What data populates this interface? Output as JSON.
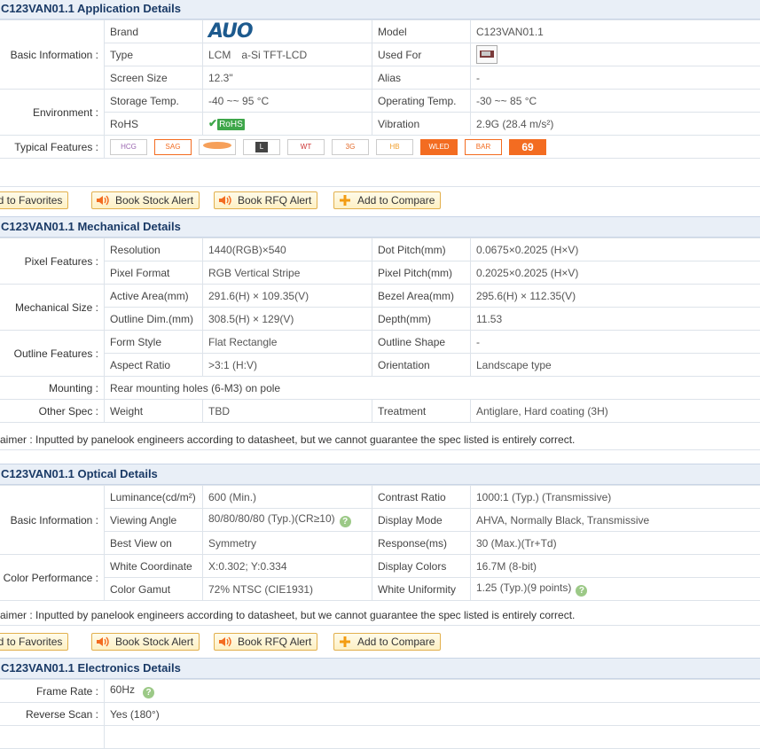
{
  "application": {
    "title": "C123VAN01.1 Application Details",
    "basic_info_header": "Basic Information :",
    "environment_header": "Environment :",
    "typical_features_header": "Typical Features :",
    "brand_label": "Brand",
    "brand_logo": "AUO",
    "model_label": "Model",
    "model_value": "C123VAN01.1",
    "type_label": "Type",
    "type_value_1": "LCM",
    "type_value_2": "a-Si TFT-LCD",
    "used_for_label": "Used For",
    "screen_size_label": "Screen Size",
    "screen_size_value": "12.3\"",
    "alias_label": "Alias",
    "alias_value": "-",
    "storage_label": "Storage Temp.",
    "storage_value": "-40 ~~ 95 °C",
    "operating_label": "Operating Temp.",
    "operating_value": "-30 ~~ 85 °C",
    "rohs_label": "RoHS",
    "rohs_badge": "RoHS",
    "vibration_label": "Vibration",
    "vibration_value": "2.9G (28.4 m/s²)",
    "features": [
      "HCG",
      "SAG",
      "",
      "L",
      "WT",
      "3G",
      "HB",
      "WLED",
      "BAR",
      "69"
    ]
  },
  "buttons": {
    "favorites": "Add to Favorites",
    "stock": "Book Stock Alert",
    "rfq": "Book RFQ Alert",
    "compare": "Add to Compare"
  },
  "mechanical": {
    "title": "C123VAN01.1 Mechanical Details",
    "pixel_features_header": "Pixel Features :",
    "mechanical_size_header": "Mechanical Size :",
    "outline_features_header": "Outline Features :",
    "mounting_header": "Mounting :",
    "other_spec_header": "Other Spec :",
    "resolution_label": "Resolution",
    "resolution_value": "1440(RGB)×540",
    "dot_pitch_label": "Dot Pitch(mm)",
    "dot_pitch_value": "0.0675×0.2025 (H×V)",
    "pixel_format_label": "Pixel Format",
    "pixel_format_value": "RGB Vertical Stripe",
    "pixel_pitch_label": "Pixel Pitch(mm)",
    "pixel_pitch_value": "0.2025×0.2025 (H×V)",
    "active_area_label": "Active Area(mm)",
    "active_area_value": "291.6(H) × 109.35(V)",
    "bezel_area_label": "Bezel Area(mm)",
    "bezel_area_value": "295.6(H) × 112.35(V)",
    "outline_dim_label": "Outline Dim.(mm)",
    "outline_dim_value": "308.5(H) × 129(V)",
    "depth_label": "Depth(mm)",
    "depth_value": "11.53",
    "form_style_label": "Form Style",
    "form_style_value": "Flat Rectangle",
    "outline_shape_label": "Outline Shape",
    "outline_shape_value": "-",
    "aspect_ratio_label": "Aspect Ratio",
    "aspect_ratio_value": ">3:1 (H:V)",
    "orientation_label": "Orientation",
    "orientation_value": "Landscape type",
    "mounting_value": "Rear mounting holes (6-M3) on pole",
    "weight_label": "Weight",
    "weight_value": "TBD",
    "treatment_label": "Treatment",
    "treatment_value": "Antiglare, Hard coating (3H)",
    "disclaimer": "aimer : Inputted by panelook engineers according to datasheet, but we cannot guarantee the spec listed is entirely correct."
  },
  "optical": {
    "title": "C123VAN01.1 Optical Details",
    "basic_info_header": "Basic Information :",
    "color_perf_header": "Color Performance :",
    "luminance_label": "Luminance(cd/m²)",
    "luminance_value": "600 (Min.)",
    "contrast_label": "Contrast Ratio",
    "contrast_value": "1000:1 (Typ.) (Transmissive)",
    "viewing_label": "Viewing Angle",
    "viewing_value": "80/80/80/80 (Typ.)(CR≥10)",
    "display_mode_label": "Display Mode",
    "display_mode_value": "AHVA, Normally Black, Transmissive",
    "best_view_label": "Best View on",
    "best_view_value": "Symmetry",
    "response_label": "Response(ms)",
    "response_value": "30 (Max.)(Tr+Td)",
    "white_coord_label": "White Coordinate",
    "white_coord_value": "X:0.302; Y:0.334",
    "display_colors_label": "Display Colors",
    "display_colors_value": "16.7M (8-bit)",
    "gamut_label": "Color Gamut",
    "gamut_value": "72% NTSC (CIE1931)",
    "uniformity_label": "White Uniformity",
    "uniformity_value": "1.25 (Typ.)(9 points)",
    "disclaimer": "aimer : Inputted by panelook engineers according to datasheet, but we cannot guarantee the spec listed is entirely correct."
  },
  "electronics": {
    "title": "C123VAN01.1 Electronics Details",
    "frame_rate_header": "Frame Rate :",
    "frame_rate_value": "60Hz",
    "reverse_scan_header": "Reverse Scan :",
    "reverse_scan_value": "Yes (180°)"
  },
  "help_glyph": "?",
  "colors": {
    "section_bg": "#e9eff7",
    "section_text": "#1a3a66",
    "button_border": "#e2b04d",
    "help_green": "#9cc987",
    "brand_blue": "#1d5a8e"
  }
}
